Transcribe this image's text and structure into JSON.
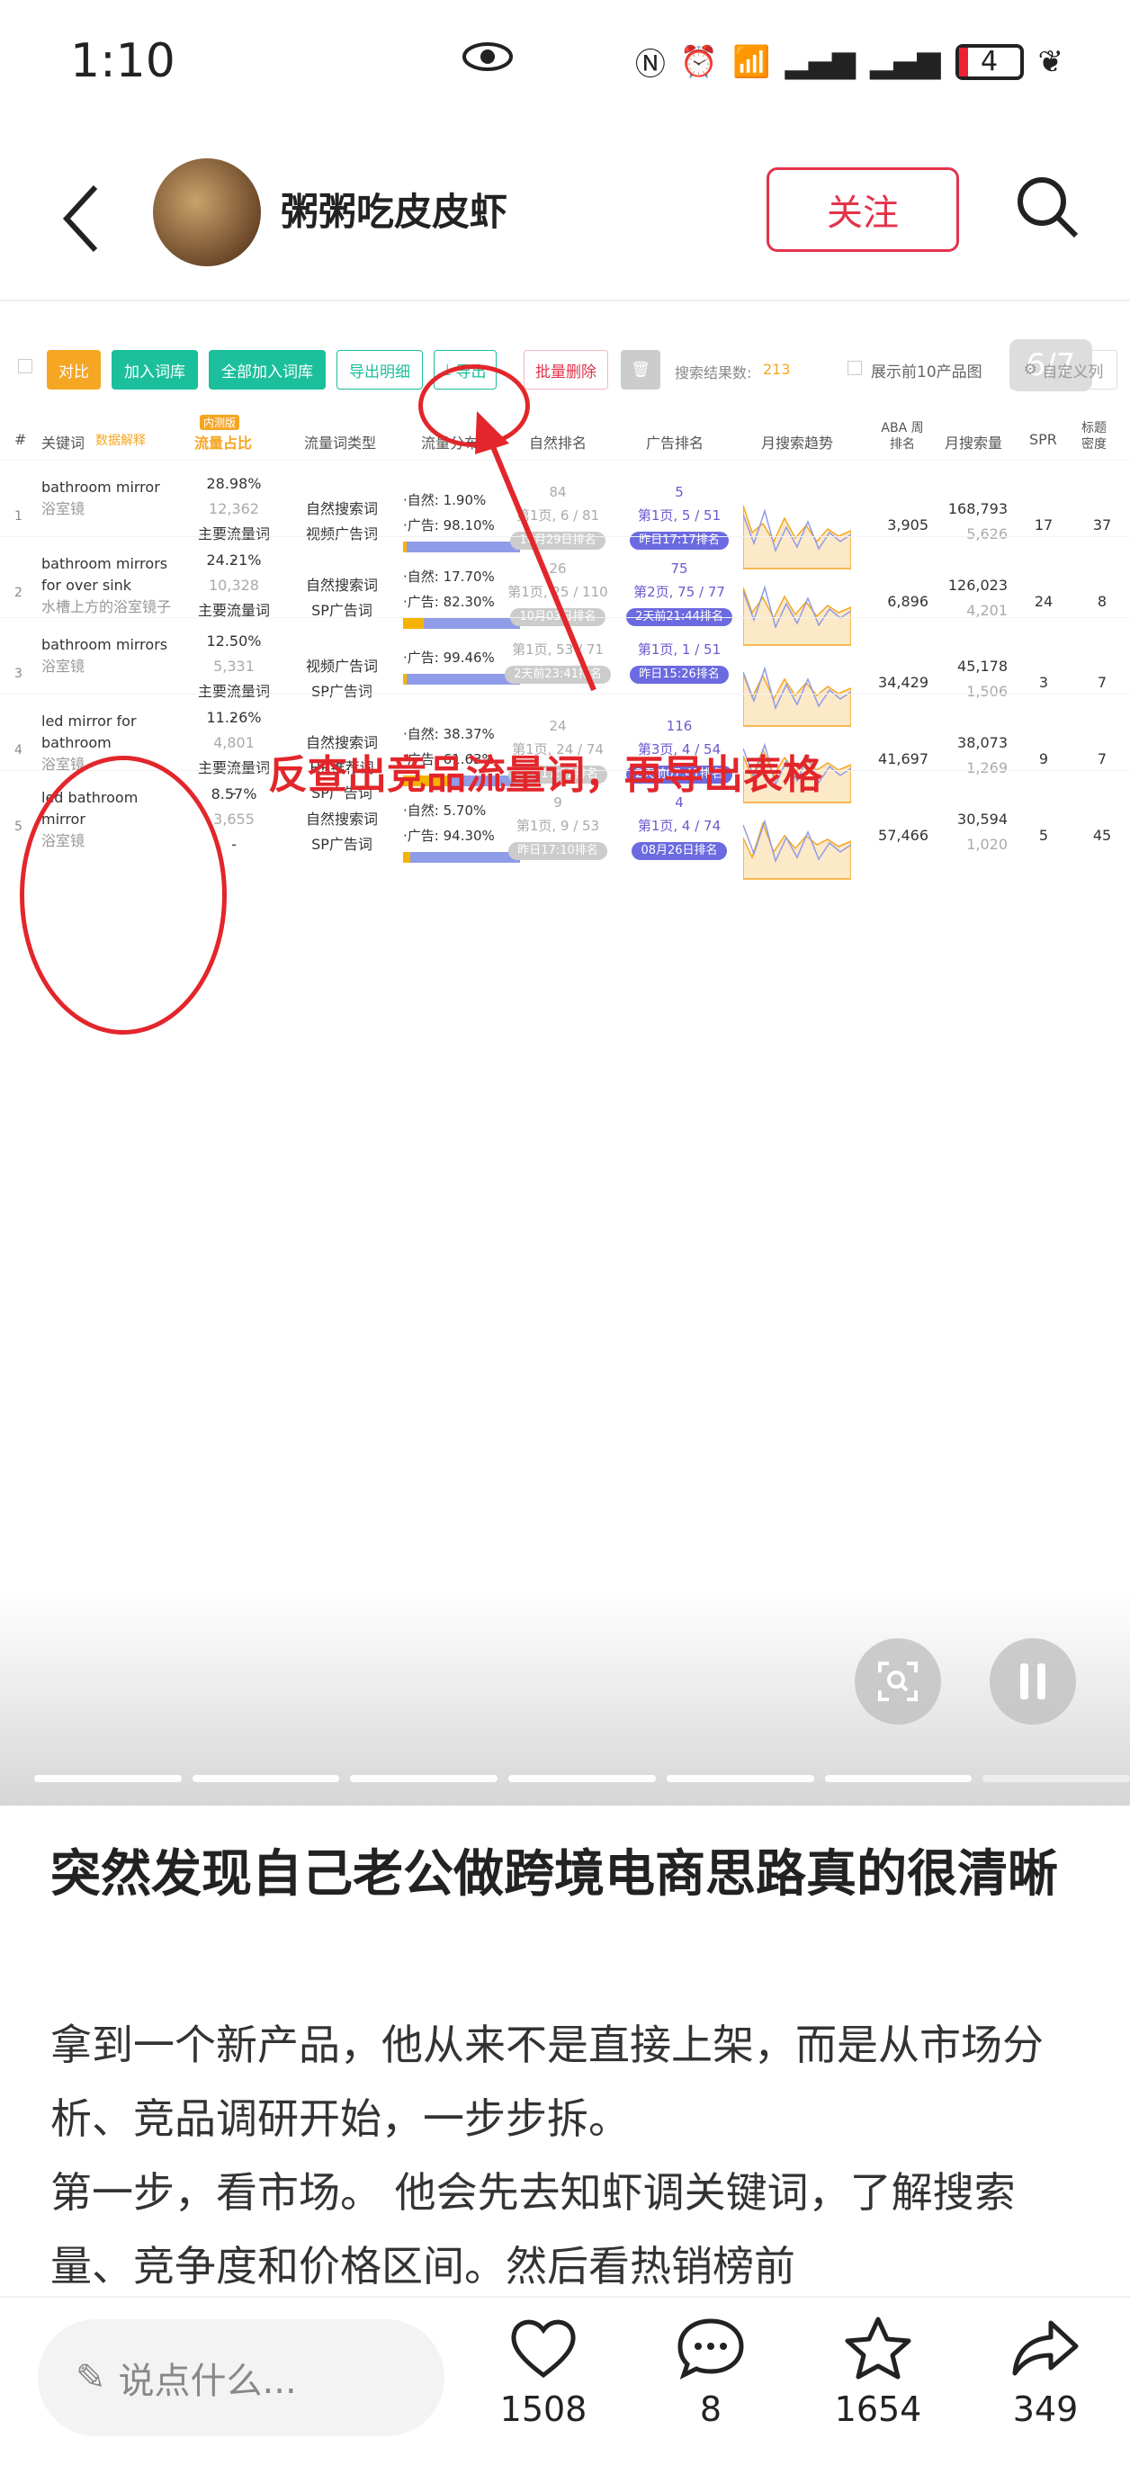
{
  "status_bar": {
    "time": "1:10",
    "battery": "4"
  },
  "header": {
    "username": "粥粥吃皮皮虾",
    "follow_label": "关注"
  },
  "media": {
    "counter": "6/7",
    "toolbar": {
      "compare": "对比",
      "add_lib": "加入词库",
      "add_all": "全部加入词库",
      "export_detail": "导出明细",
      "export": "导出",
      "batch_delete": "批量删除",
      "result_label": "搜索结果数:",
      "result_count": "213",
      "show_top": "展示前10产品图",
      "custom_col": "自定义列"
    },
    "columns": {
      "idx": "#",
      "keyword": "关键词",
      "keyword_hint": "数据解释",
      "share_badge": "内测版",
      "share": "流量占比",
      "ttype": "流量词类型",
      "dist": "流量分布",
      "natural": "自然排名",
      "ad": "广告排名",
      "trend": "月搜索趋势",
      "aba": "ABA 周排名",
      "monthly": "月搜索量",
      "spr": "SPR",
      "density": "标题 密度"
    },
    "rows": [
      {
        "idx": "1",
        "kw": "bathroom mirror",
        "kw_cn": "浴室镜",
        "share": "28.98%",
        "share_sub": "12,362",
        "share_tag": "主要流量词",
        "dash": "-",
        "types": [
          "自然搜索词",
          "视频广告词"
        ],
        "nat_label": "·自然:",
        "nat": "1.90%",
        "ad_label": "·广告:",
        "ad_pct": "98.10%",
        "nat_rank": "84",
        "nat_page": "第1页, 6 / 81",
        "nat_pill": "10月29日排名",
        "ad_rank": "5",
        "ad_page": "第1页, 5 / 51",
        "ad_pill": "昨日17:17排名",
        "aba": "3,905",
        "monthly": "168,793",
        "monthly_sub": "5,626",
        "spr": "17",
        "density": "37"
      },
      {
        "idx": "2",
        "kw": "bathroom mirrors for over sink",
        "kw_cn": "水槽上方的浴室镜子",
        "share": "24.21%",
        "share_sub": "10,328",
        "share_tag": "主要流量词",
        "dash": "-",
        "types": [
          "自然搜索词",
          "SP广告词"
        ],
        "nat_label": "·自然:",
        "nat": "17.70%",
        "ad_label": "·广告:",
        "ad_pct": "82.30%",
        "nat_rank": "26",
        "nat_page": "第1页, 25 / 110",
        "nat_pill": "10月03日排名",
        "ad_rank": "75",
        "ad_page": "第2页, 75 / 77",
        "ad_pill": "2天前21:44排名",
        "aba": "6,896",
        "monthly": "126,023",
        "monthly_sub": "4,201",
        "spr": "24",
        "density": "8"
      },
      {
        "idx": "3",
        "kw": "bathroom mirrors",
        "kw_cn": "浴室镜",
        "share": "12.50%",
        "share_sub": "5,331",
        "share_tag": "主要流量词",
        "dash": "-",
        "types": [
          "视频广告词",
          "SP广告词"
        ],
        "nat_label": "",
        "nat": "",
        "ad_label": "·广告:",
        "ad_pct": "99.46%",
        "nat_rank": "",
        "nat_page": "第1页, 53 / 71",
        "nat_pill": "2天前23:41排名",
        "ad_rank": "",
        "ad_page": "第1页, 1 / 51",
        "ad_pill": "昨日15:26排名",
        "aba": "34,429",
        "monthly": "45,178",
        "monthly_sub": "1,506",
        "spr": "3",
        "density": "7"
      },
      {
        "idx": "4",
        "kw": "led mirror for bathroom",
        "kw_cn": "浴室镜",
        "share": "11.26%",
        "share_sub": "4,801",
        "share_tag": "主要流量词",
        "dash": "-",
        "types": [
          "自然搜索词",
          "HR推荐词",
          "SP广告词"
        ],
        "nat_label": "·自然:",
        "nat": "38.37%",
        "ad_label": "·广告:",
        "ad_pct": "61.63%",
        "nat_rank": "24",
        "nat_page": "第1页, 24 / 74",
        "nat_pill": "昨日17:12排名",
        "ad_rank": "116",
        "ad_page": "第3页, 4 / 54",
        "ad_pill": "2天前07:41排名",
        "aba": "41,697",
        "monthly": "38,073",
        "monthly_sub": "1,269",
        "spr": "9",
        "density": "7"
      },
      {
        "idx": "5",
        "kw": "led bathroom mirror",
        "kw_cn": "浴室镜",
        "share": "8.57%",
        "share_sub": "3,655",
        "share_tag": "",
        "dash": "-",
        "types": [
          "自然搜索词",
          "SP广告词"
        ],
        "nat_label": "·自然:",
        "nat": "5.70%",
        "ad_label": "·广告:",
        "ad_pct": "94.30%",
        "nat_rank": "9",
        "nat_page": "第1页, 9 / 53",
        "nat_pill": "昨日17:10排名",
        "ad_rank": "4",
        "ad_page": "第1页, 4 / 74",
        "ad_pill": "08月26日排名",
        "aba": "57,466",
        "monthly": "30,594",
        "monthly_sub": "1,020",
        "spr": "5",
        "density": "45"
      }
    ],
    "annotation": "反查出竞品流量词，再导出表格"
  },
  "post": {
    "title": "突然发现自己老公做跨境电商思路真的很清晰",
    "body": [
      "拿到一个新产品，他从来不是直接上架，而是从市场分析、竞品调研开始，一步步拆。",
      "第一步，看市场。 他会先去知虾调关键词，了解搜索量、竞争度和价格区间。然后看热销榜前"
    ]
  },
  "bottom_bar": {
    "comment_placeholder": "说点什么...",
    "likes": "1508",
    "comments": "8",
    "favorites": "1654",
    "shares": "349"
  },
  "colors": {
    "accent": "#e2344b",
    "annotation": "#e2262b",
    "toolbar_green": "#1bbf9b",
    "orange": "#f5a623"
  }
}
